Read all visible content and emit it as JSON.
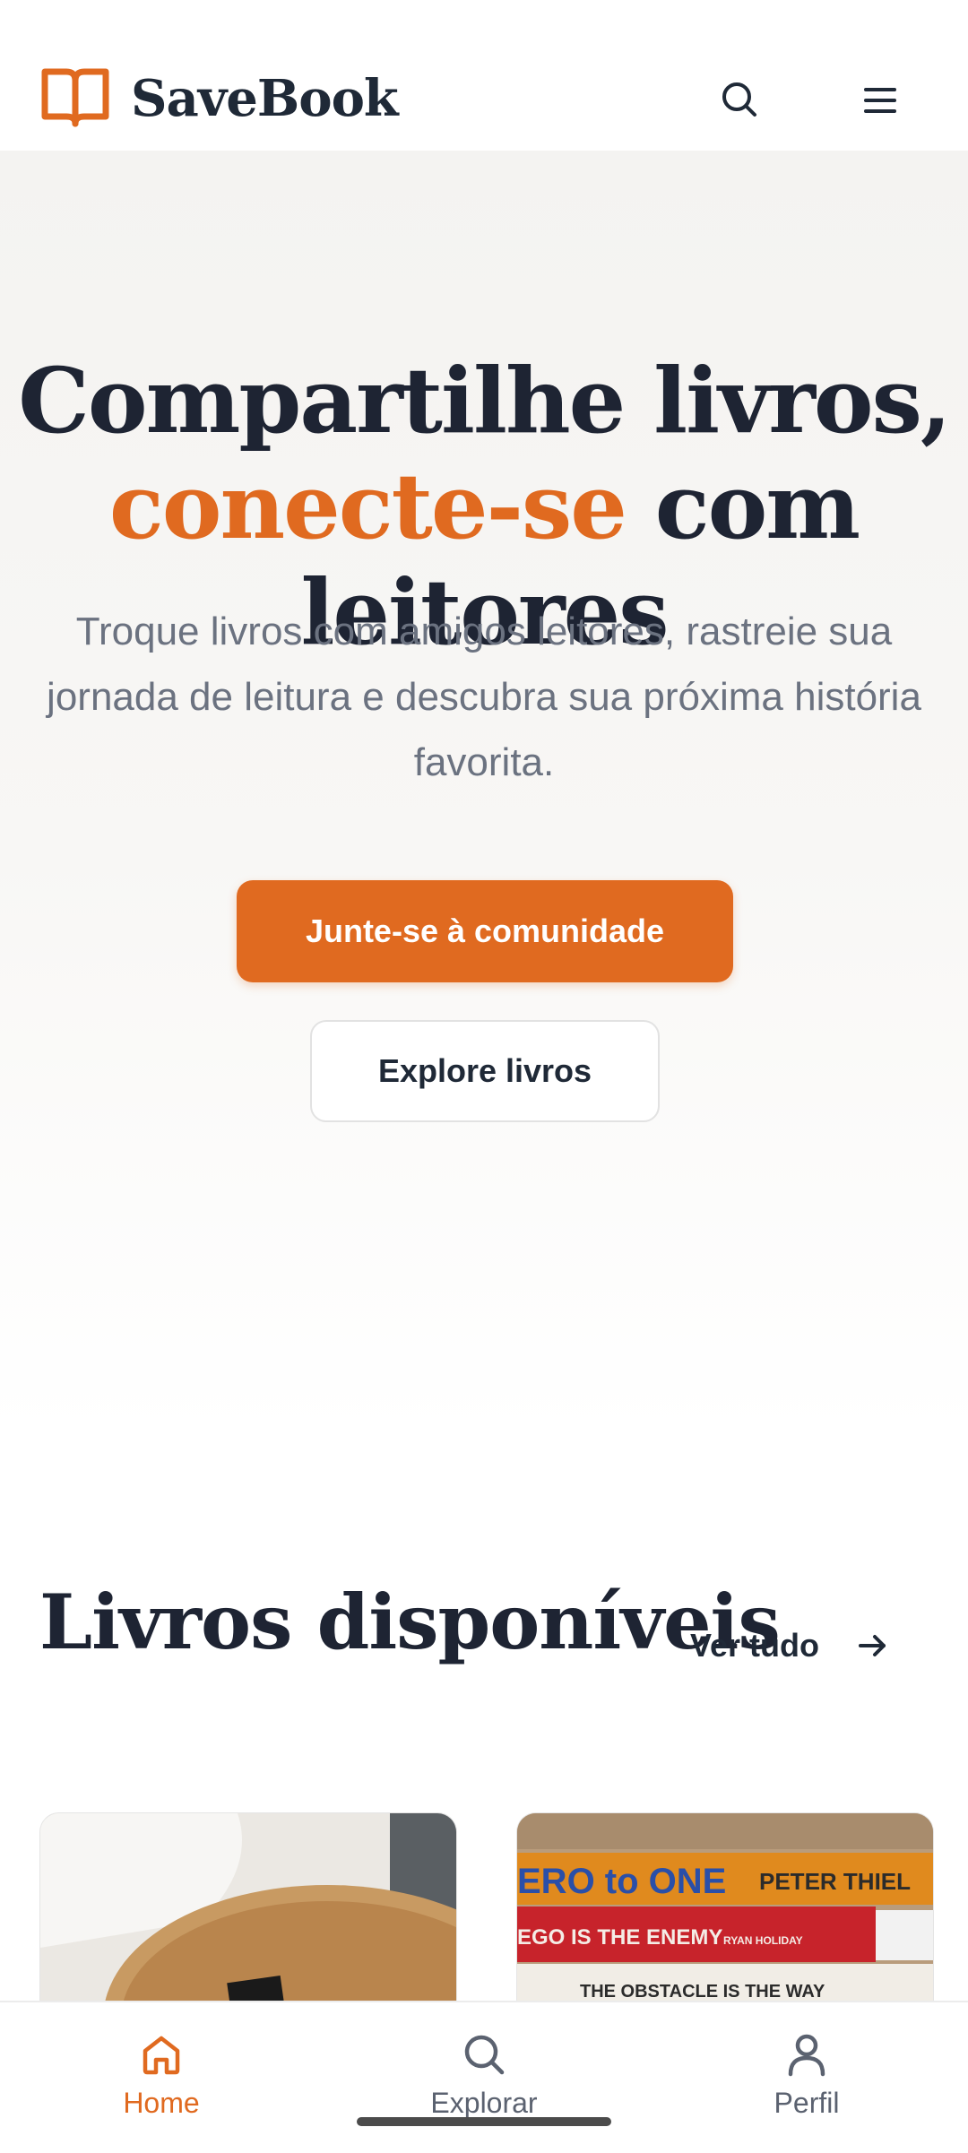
{
  "header": {
    "brand": "SaveBook",
    "logo_icon": "open-book-icon",
    "search_icon": "search-icon",
    "menu_icon": "hamburger-menu-icon"
  },
  "hero": {
    "title_line1": "Compartilhe livros,",
    "title_accent": "conecte-se",
    "title_rest": " com leitores",
    "subtitle": "Troque livros com amigos leitores, rastreie sua jornada de leitura e descubra sua próxima história favorita.",
    "primary_button": "Junte-se à comunidade",
    "secondary_button": "Explore livros"
  },
  "books_section": {
    "title": "Livros disponíveis",
    "see_all": "Ver tudo",
    "see_all_icon": "arrow-right-icon",
    "cover_a_text": "",
    "cover_b_lines": [
      "ERO to ONE",
      "PETER THIEL",
      "EGO IS THE ENEMY",
      "RYAN HOLIDAY",
      "THE OBSTACLE IS THE WAY"
    ]
  },
  "bottom_nav": {
    "items": [
      {
        "label": "Home",
        "icon": "home-icon",
        "active": true
      },
      {
        "label": "Explorar",
        "icon": "search-icon",
        "active": false
      },
      {
        "label": "Perfil",
        "icon": "user-icon",
        "active": false
      }
    ]
  },
  "colors": {
    "accent": "#e06a20",
    "title": "#1e2433",
    "subtitle": "#6b7280"
  }
}
